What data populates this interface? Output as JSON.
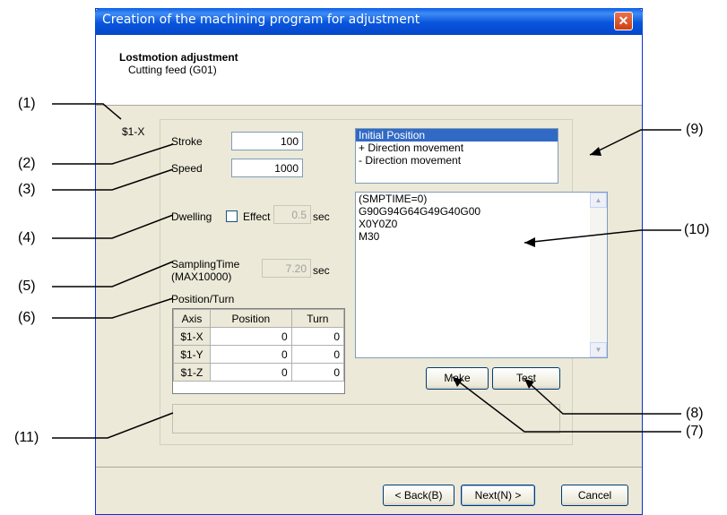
{
  "window": {
    "title": "Creation of the machining program for adjustment",
    "close_glyph": "✕"
  },
  "header": {
    "title": "Lostmotion adjustment",
    "subtitle": "Cutting feed (G01)"
  },
  "axis_label": "$1-X",
  "stroke": {
    "label": "Stroke",
    "value": "100"
  },
  "speed": {
    "label": "Speed",
    "value": "1000"
  },
  "dwelling": {
    "label": "Dwelling",
    "checkbox_label": "Effect",
    "checked": false,
    "value": "0.5",
    "unit": "sec"
  },
  "sampling": {
    "label_line1": "SamplingTime",
    "label_line2": "(MAX10000)",
    "value": "7.20",
    "unit": "sec"
  },
  "position_turn": {
    "label": "Position/Turn",
    "headers": [
      "Axis",
      "Position",
      "Turn"
    ],
    "rows": [
      {
        "axis": "$1-X",
        "position": "0",
        "turn": "0"
      },
      {
        "axis": "$1-Y",
        "position": "0",
        "turn": "0"
      },
      {
        "axis": "$1-Z",
        "position": "0",
        "turn": "0"
      }
    ]
  },
  "mode_list": {
    "items": [
      "Initial Position",
      "+ Direction movement",
      "- Direction movement"
    ],
    "selected_index": 0
  },
  "program_lines": [
    "(SMPTIME=0)",
    "G90G94G64G49G40G00",
    "X0Y0Z0",
    "M30"
  ],
  "buttons": {
    "make": "Make",
    "test": "Test",
    "back": "< Back(B)",
    "next": "Next(N) >",
    "cancel": "Cancel"
  },
  "callouts": {
    "c1": "(1)",
    "c2": "(2)",
    "c3": "(3)",
    "c4": "(4)",
    "c5": "(5)",
    "c6": "(6)",
    "c7": "(7)",
    "c8": "(8)",
    "c9": "(9)",
    "c10": "(10)",
    "c11": "(11)"
  },
  "colors": {
    "title_bar": "#0a5ee9",
    "selection": "#316ac5",
    "window_bg": "#ece9d8"
  }
}
